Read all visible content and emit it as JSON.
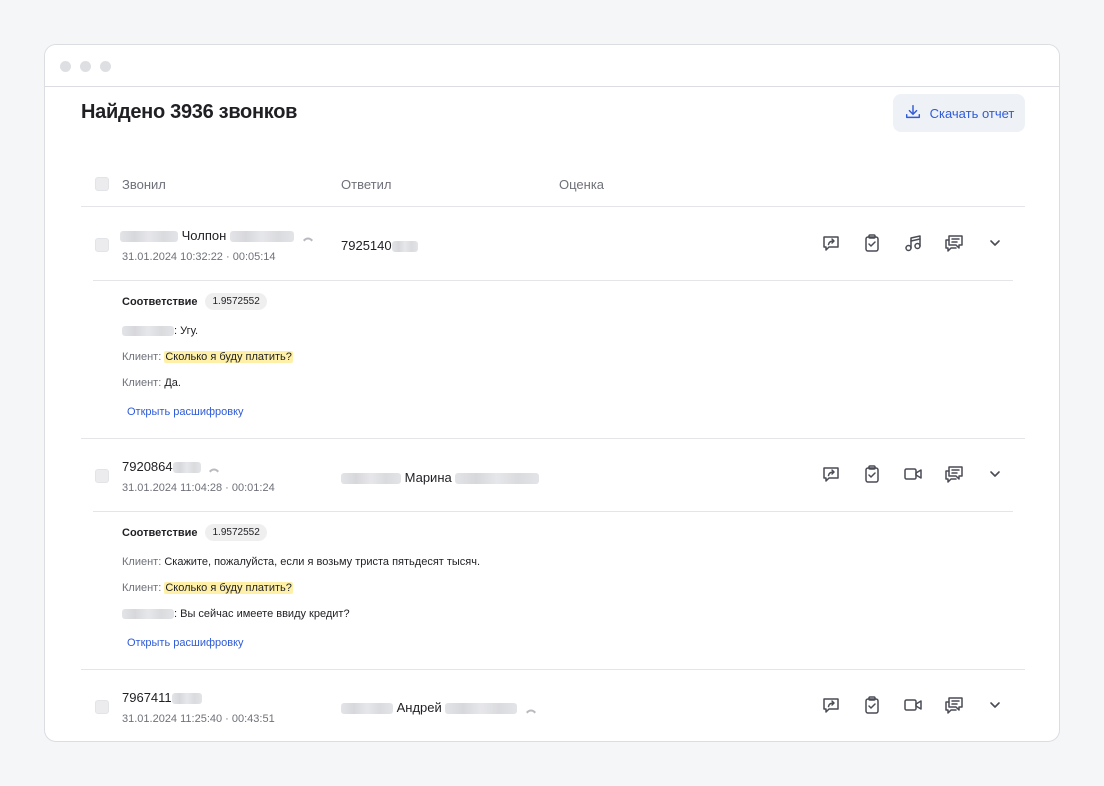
{
  "page": {
    "title": "Найдено 3936 звонков",
    "download_label": "Скачать отчет",
    "accent": "#2f5bd8",
    "highlight": "#fff0a8"
  },
  "table": {
    "headers": {
      "caller": "Звонил",
      "answered": "Ответил",
      "rating": "Оценка"
    }
  },
  "calls": [
    {
      "caller": "Чолпон",
      "meta": "31.01.2024 10:32:22 · 00:05:14",
      "answered": "7925140",
      "icons": [
        "share-icon",
        "clipboard-check-icon",
        "music-note-icon",
        "chat-bubbles-icon",
        "chevron-down-icon"
      ],
      "match_label": "Соответствие",
      "match_score": "1.9572552",
      "lines": [
        {
          "speaker": "",
          "text": ": Угу.",
          "highlight": false
        },
        {
          "speaker": "Клиент: ",
          "text": "Сколько я буду платить?",
          "highlight": true
        },
        {
          "speaker": "Клиент: ",
          "text": "Да.",
          "highlight": false
        }
      ],
      "open_label": "Открыть расшифровку"
    },
    {
      "caller": "7920864",
      "meta": "31.01.2024 11:04:28 · 00:01:24",
      "answered": "Марина",
      "icons": [
        "share-icon",
        "clipboard-check-icon",
        "video-camera-icon",
        "chat-bubbles-icon",
        "chevron-down-icon"
      ],
      "match_label": "Соответствие",
      "match_score": "1.9572552",
      "lines": [
        {
          "speaker": "Клиент: ",
          "text": "Скажите, пожалуйста, если я возьму триста пятьдесят тысяч.",
          "highlight": false
        },
        {
          "speaker": "Клиент: ",
          "text": "Сколько я буду платить?",
          "highlight": true
        },
        {
          "speaker": "",
          "text": ": Вы сейчас имеете ввиду кредит?",
          "highlight": false
        }
      ],
      "open_label": "Открыть расшифровку"
    },
    {
      "caller": "7967411",
      "meta": "31.01.2024 11:25:40 · 00:43:51",
      "answered": "Андрей",
      "icons": [
        "share-icon",
        "clipboard-check-icon",
        "video-camera-icon",
        "chat-bubbles-icon",
        "chevron-down-icon"
      ]
    }
  ]
}
